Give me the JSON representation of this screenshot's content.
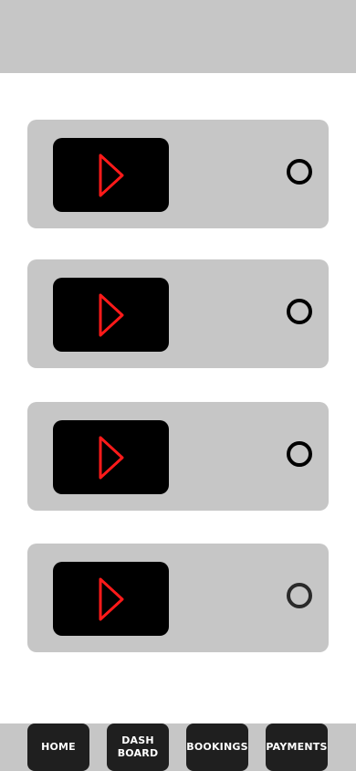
{
  "nav": {
    "home": "HOME",
    "dashboard": "DASH\nBOARD",
    "bookings": "BOOKINGS",
    "payments": "PAYMENTS"
  },
  "icons": {
    "play": "play-icon",
    "radio": "radio-unchecked-icon"
  },
  "colors": {
    "header_bg": "#c6c6c6",
    "card_bg": "#c6c6c6",
    "thumb_bg": "#000000",
    "play_stroke": "#ff1a1a",
    "nav_btn_bg": "#1f1f1f",
    "nav_text": "#ffffff"
  }
}
